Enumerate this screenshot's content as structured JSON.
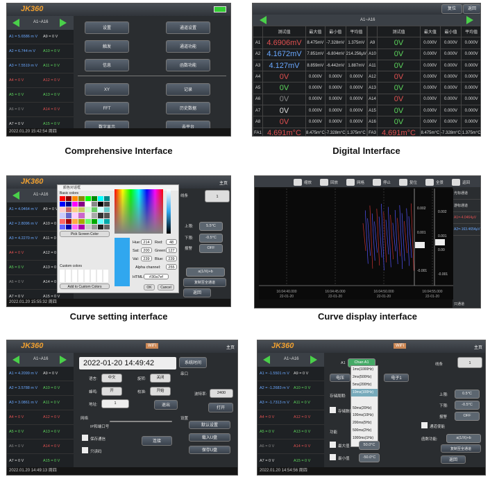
{
  "captions": {
    "comprehensive": "Comprehensive Interface",
    "digital": "Digital Interface",
    "curve_setting": "Curve setting interface",
    "curve_display": "Curve display interface"
  },
  "common": {
    "logo": "JK360",
    "range": "A1~A16",
    "wifi": "WiFi",
    "home": "主页"
  },
  "p1": {
    "status": "2022.01.20 15:42:54 周四",
    "rows": [
      {
        "a": "A1 = 5.6586 m V",
        "b": "A9 = 0 V",
        "ca": "c-blue",
        "cb": "c-white"
      },
      {
        "a": "A2 = 6.744 m V",
        "b": "A10 = 0 V",
        "ca": "c-blue",
        "cb": "c-green"
      },
      {
        "a": "A3 = 7.5519 m V",
        "b": "A11 = 0 V",
        "ca": "c-blue",
        "cb": "c-green"
      },
      {
        "a": "A4 = 0 V",
        "b": "A12 = 0 V",
        "ca": "c-red",
        "cb": "c-red"
      },
      {
        "a": "A5 = 0 V",
        "b": "A13 = 0 V",
        "ca": "c-green",
        "cb": "c-green"
      },
      {
        "a": "A6 = 0 V",
        "b": "A14 = 0 V",
        "ca": "c-gray",
        "cb": "c-red"
      },
      {
        "a": "A7 = 0 V",
        "b": "A15 = 0 V",
        "ca": "c-white",
        "cb": "c-green"
      },
      {
        "a": "A8 = 0 V",
        "b": "A16 = 0 V",
        "ca": "c-red",
        "cb": "c-green"
      }
    ],
    "menu": [
      "设置",
      "通道设置",
      "触发",
      "通道功能",
      "信息",
      "函数功能",
      "XY",
      "记录",
      "FFT",
      "历史数据",
      "数字显示",
      "去平台"
    ]
  },
  "p2": {
    "reset": "复位",
    "back": "返回",
    "headers": [
      "测试值",
      "最大值",
      "最小值",
      "平均值"
    ],
    "left": [
      {
        "ch": "A1",
        "v": "4.6906mV",
        "mx": "8.475mV",
        "mn": "-7.328mV",
        "av": "1.375mV",
        "c": "c-red"
      },
      {
        "ch": "A2",
        "v": "4.1672mV",
        "mx": "7.851mV",
        "mn": "-6.804mV",
        "av": "214.256μV",
        "c": "c-blue"
      },
      {
        "ch": "A3",
        "v": "4.127mV",
        "mx": "8.859mV",
        "mn": "-6.442mV",
        "av": "1.887mV",
        "c": "c-blue"
      },
      {
        "ch": "A4",
        "v": "0V",
        "mx": "0.000V",
        "mn": "0.000V",
        "av": "0.000V",
        "c": "c-red"
      },
      {
        "ch": "A5",
        "v": "0V",
        "mx": "0.000V",
        "mn": "0.000V",
        "av": "0.000V",
        "c": "c-green"
      },
      {
        "ch": "A6",
        "v": "0V",
        "mx": "0.000V",
        "mn": "0.000V",
        "av": "0.000V",
        "c": "c-gray"
      },
      {
        "ch": "A7",
        "v": "0V",
        "mx": "0.000V",
        "mn": "0.000V",
        "av": "0.000V",
        "c": "c-white"
      },
      {
        "ch": "A8",
        "v": "0V",
        "mx": "0.000V",
        "mn": "0.000V",
        "av": "0.000V",
        "c": "c-red"
      },
      {
        "ch": "FA1",
        "v": "4.691m°C",
        "mx": "8.475m°C",
        "mn": "-7.328m°C",
        "av": "1.375m°C",
        "c": "c-red"
      },
      {
        "ch": "FA2",
        "v": "4.691m°C",
        "mx": "8.475m°C",
        "mn": "-7.328m°C",
        "av": "1.375m°C",
        "c": "c-blue"
      }
    ],
    "right": [
      {
        "ch": "A9",
        "v": "0V",
        "mx": "0.000V",
        "mn": "0.000V",
        "av": "0.000V",
        "c": "c-green"
      },
      {
        "ch": "A10",
        "v": "0V",
        "mx": "0.000V",
        "mn": "0.000V",
        "av": "0.000V",
        "c": "c-green"
      },
      {
        "ch": "A11",
        "v": "0V",
        "mx": "0.000V",
        "mn": "0.000V",
        "av": "0.000V",
        "c": "c-green"
      },
      {
        "ch": "A12",
        "v": "0V",
        "mx": "0.000V",
        "mn": "0.000V",
        "av": "0.000V",
        "c": "c-red"
      },
      {
        "ch": "A13",
        "v": "0V",
        "mx": "0.000V",
        "mn": "0.000V",
        "av": "0.000V",
        "c": "c-green"
      },
      {
        "ch": "A14",
        "v": "0V",
        "mx": "0.000V",
        "mn": "0.000V",
        "av": "0.000V",
        "c": "c-red"
      },
      {
        "ch": "A15",
        "v": "0V",
        "mx": "0.000V",
        "mn": "0.000V",
        "av": "0.000V",
        "c": "c-green"
      },
      {
        "ch": "A16",
        "v": "0V",
        "mx": "0.000V",
        "mn": "0.000V",
        "av": "0.000V",
        "c": "c-green"
      },
      {
        "ch": "FA3",
        "v": "4.691m°C",
        "mx": "8.475m°C",
        "mn": "-7.328m°C",
        "av": "1.375m°C",
        "c": "c-red"
      },
      {
        "ch": "FA4",
        "v": "4.691m°C",
        "mx": "8.475m°C",
        "mn": "-7.328m°C",
        "av": "1.375m°C",
        "c": "c-blue"
      }
    ]
  },
  "p3": {
    "status": "2022.01.20 15:55:32 周四",
    "dialog_title": "颜色对话框",
    "basic": "Basic colors",
    "pick": "Pick Screen Color",
    "custom": "Custom colors",
    "add": "Add to Custom Colors",
    "hue": "Hue:",
    "hue_v": "214",
    "sat": "Sat:",
    "sat_v": "200",
    "val": "Val:",
    "val_v": "239",
    "red": "Red:",
    "red_v": "48",
    "green": "Green:",
    "green_v": "127",
    "blue": "Blue:",
    "blue_v": "239",
    "alpha": "Alpha channel:",
    "alpha_v": "255",
    "html": "HTML:",
    "html_v": "#30a7ef",
    "ok": "OK",
    "cancel": "Cancel",
    "line": "线条",
    "line_v": "1",
    "upper": "上限:",
    "upper_v": "5.5°C",
    "lower": "下限:",
    "lower_v": "-0.5°C",
    "alarm": "报警",
    "alarm_v": "OFF",
    "apply": "a(1/X)+b",
    "copy": "复制至全通道",
    "ret": "返回",
    "rows": [
      {
        "a": "A1 = 4.0464 m V",
        "b": "A9 = 0 V",
        "ca": "c-blue",
        "cb": "c-white"
      },
      {
        "a": "A2 = 2.8096 m V",
        "b": "A10 = 0 V",
        "ca": "c-blue",
        "cb": "c-white"
      },
      {
        "a": "A3 = 4.2270 m V",
        "b": "A11 = 0 V",
        "ca": "c-blue",
        "cb": "c-white"
      },
      {
        "a": "A4 = 0 V",
        "b": "A12 = 0 V",
        "ca": "c-red",
        "cb": "c-white"
      },
      {
        "a": "A5 = 0 V",
        "b": "A13 = 0 V",
        "ca": "c-green",
        "cb": "c-white"
      },
      {
        "a": "A6 = 0 V",
        "b": "A14 = 0 V",
        "ca": "c-gray",
        "cb": "c-white"
      },
      {
        "a": "A7 = 0 V",
        "b": "A15 = 0 V",
        "ca": "c-white",
        "cb": "c-white"
      },
      {
        "a": "A8 = 0 V",
        "b": "A16 = 0 V",
        "ca": "c-red",
        "cb": "c-white"
      }
    ]
  },
  "p4": {
    "toolbar": [
      "缩放",
      "回放",
      "网格",
      "停止",
      "复位",
      "全景",
      "返回"
    ],
    "side": [
      "光标通道",
      "游标通道",
      "A1=-4.0464μV",
      "A2=-163.4654μV",
      "只通道"
    ],
    "times": [
      "16:04:40.000",
      "16:04:45.000",
      "16:04:50.000",
      "16:04:55.000"
    ],
    "date": "22-01-20",
    "axis": [
      "0.002",
      "0.001",
      "0.00",
      "-0.001"
    ]
  },
  "p5": {
    "status": "2022.01.20 14:49:13 周四",
    "datetime": "2022-01-20 14:49:42",
    "sys": "系统时间",
    "serial": "串口",
    "lang": "语言:",
    "lang_v": "中文",
    "rot": "旋转:",
    "rot_v": "关闭",
    "beep": "蜂鸣:",
    "beep_v": "开",
    "dir": "校准:",
    "dir_v": "开始",
    "addr": "地址:",
    "addr_v": "1",
    "baud": "波特率:",
    "baud_v": "2400",
    "open": "打开",
    "exit": "退出",
    "net": "网络",
    "set": "设置",
    "ip": "IP和端口号",
    "sd": "保存通信",
    "usb_set": "只读码",
    "connect": "连接",
    "reset": "默认设置",
    "import": "载入U盘",
    "save": "保存U盘",
    "rows": [
      {
        "a": "A1 = 4.2099 m V",
        "b": "A9 = 0 V",
        "ca": "c-blue",
        "cb": "c-white"
      },
      {
        "a": "A2 = 3.5788 m V",
        "b": "A10 = 0 V",
        "ca": "c-blue",
        "cb": "c-green"
      },
      {
        "a": "A3 = 3.0861 m V",
        "b": "A11 = 0 V",
        "ca": "c-blue",
        "cb": "c-green"
      },
      {
        "a": "A4 = 0 V",
        "b": "A12 = 0 V",
        "ca": "c-red",
        "cb": "c-red"
      },
      {
        "a": "A5 = 0 V",
        "b": "A13 = 0 V",
        "ca": "c-green",
        "cb": "c-green"
      },
      {
        "a": "A6 = 0 V",
        "b": "A14 = 0 V",
        "ca": "c-gray",
        "cb": "c-red"
      },
      {
        "a": "A7 = 0 V",
        "b": "A15 = 0 V",
        "ca": "c-white",
        "cb": "c-green"
      },
      {
        "a": "A8 = 0 V",
        "b": "A16 = 0 V",
        "ca": "c-red",
        "cb": "c-green"
      }
    ]
  },
  "p6": {
    "status": "2022.01.20 14:54:56 周四",
    "ch": "A1",
    "ch_v": "Chan A1",
    "line": "线条",
    "line_v": "1",
    "volt": "电压",
    "hot": "热电偶",
    "ohm": "电子1",
    "storage": "存储周期:",
    "save": "存储数据",
    "func": "功能",
    "periods": [
      "1ms(1000Hz)",
      "2ms(500Hz)",
      "5ms(200Hz)",
      "10ms(100Hz)",
      "50ms(20Hz)",
      "100ms(10Hz)",
      "200ms(5Hz)",
      "500ms(2Hz)",
      "1000ms(1Hz)"
    ],
    "upper": "上限:",
    "upper_v": "0.5°C",
    "lower": "下限:",
    "lower_v": "-0.5°C",
    "alarm": "报警",
    "alarm_v": "OFF",
    "chan": "通道使能",
    "fn": "函数功能:",
    "fn_v": "a(1/X)+b",
    "copy": "复制至全通道",
    "ret": "返回",
    "max": "最大值",
    "max_v": "50.0°C",
    "min": "最小值",
    "min_v": "-50.0°C",
    "rows": [
      {
        "a": "A1 = -1.5501 m V",
        "b": "A9 = 0 V",
        "ca": "c-blue",
        "cb": "c-white"
      },
      {
        "a": "A2 = -1.2683 m V",
        "b": "A10 = 0 V",
        "ca": "c-blue",
        "cb": "c-green"
      },
      {
        "a": "A3 = -1.7313 m V",
        "b": "A11 = 0 V",
        "ca": "c-blue",
        "cb": "c-green"
      },
      {
        "a": "A4 = 0 V",
        "b": "A12 = 0 V",
        "ca": "c-red",
        "cb": "c-red"
      },
      {
        "a": "A5 = 0 V",
        "b": "A13 = 0 V",
        "ca": "c-green",
        "cb": "c-green"
      },
      {
        "a": "A6 = 0 V",
        "b": "A14 = 0 V",
        "ca": "c-gray",
        "cb": "c-red"
      },
      {
        "a": "A7 = 0 V",
        "b": "A15 = 0 V",
        "ca": "c-white",
        "cb": "c-green"
      },
      {
        "a": "A8 = 0 V",
        "b": "A16 = 0 V",
        "ca": "c-red",
        "cb": "c-green"
      }
    ]
  }
}
